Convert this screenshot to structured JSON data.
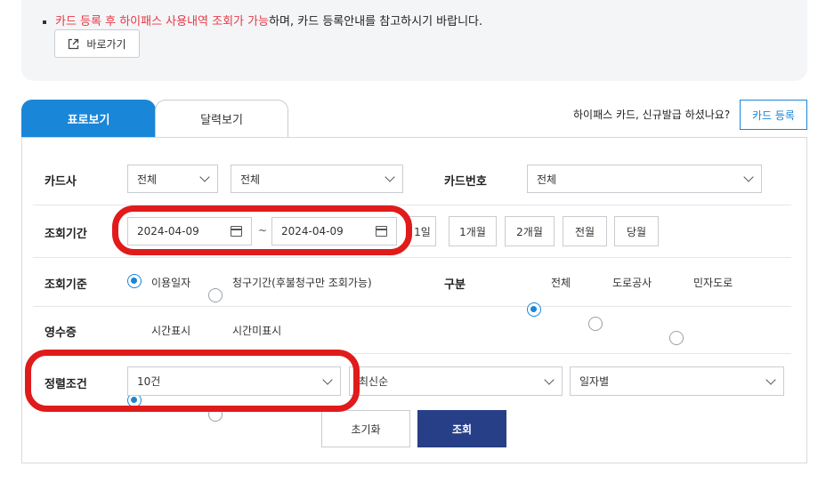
{
  "notice": {
    "text_red": "카드 등록 후 하이패스 사용내역 조회가 가능",
    "text_rest": "하며, 카드 등록안내를 참고하시기 바랍니다.",
    "goto_label": "바로가기"
  },
  "tabs": [
    {
      "label": "표로보기",
      "active": true
    },
    {
      "label": "달력보기",
      "active": false
    }
  ],
  "promo": {
    "question": "하이패스 카드, 신규발급 하셨나요?",
    "register_label": "카드 등록"
  },
  "form": {
    "card_company": {
      "label": "카드사",
      "select1": "전체",
      "select2": "전체"
    },
    "card_number": {
      "label": "카드번호",
      "value": "전체"
    },
    "period": {
      "label": "조회기간",
      "start": "2024-04-09",
      "separator": "~",
      "end": "2024-04-09",
      "quick_buttons": [
        "1일",
        "1개월",
        "2개월",
        "전월",
        "당월"
      ]
    },
    "criteria": {
      "label": "조회기준",
      "options": [
        {
          "label": "이용일자",
          "checked": true
        },
        {
          "label": "청구기간(후불청구만 조회가능)",
          "checked": false
        }
      ]
    },
    "category": {
      "label": "구분",
      "options": [
        {
          "label": "전체",
          "checked": true
        },
        {
          "label": "도로공사",
          "checked": false
        },
        {
          "label": "민자도로",
          "checked": false
        }
      ]
    },
    "receipt": {
      "label": "영수증",
      "options": [
        {
          "label": "시간표시",
          "checked": true
        },
        {
          "label": "시간미표시",
          "checked": false
        }
      ]
    },
    "sort": {
      "label": "정렬조건",
      "count": "10건",
      "order": "최신순",
      "group": "일자별"
    },
    "reset_label": "초기화",
    "search_label": "조회"
  },
  "colors": {
    "accent_blue": "#1a86d8",
    "search_navy": "#263f86",
    "highlight_red": "#e01b1b",
    "notice_red": "#e63946"
  }
}
